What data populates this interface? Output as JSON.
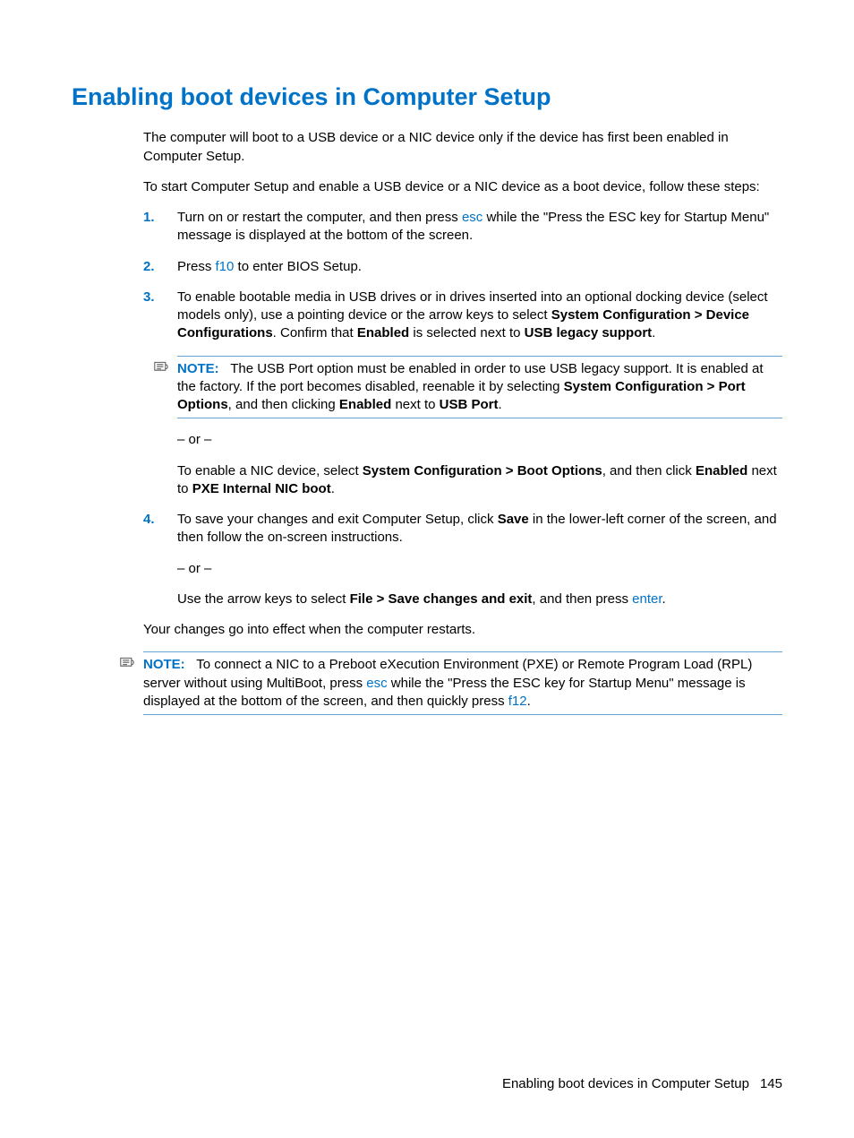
{
  "heading": "Enabling boot devices in Computer Setup",
  "intro1": "The computer will boot to a USB device or a NIC device only if the device has first been enabled in Computer Setup.",
  "intro2": "To start Computer Setup and enable a USB device or a NIC device as a boot device, follow these steps:",
  "steps": {
    "s1": {
      "num": "1.",
      "t1": "Turn on or restart the computer, and then press ",
      "key1": "esc",
      "t2": " while the \"Press the ESC key for Startup Menu\" message is displayed at the bottom of the screen."
    },
    "s2": {
      "num": "2.",
      "t1": "Press ",
      "key1": "f10",
      "t2": " to enter BIOS Setup."
    },
    "s3": {
      "num": "3.",
      "t1": "To enable bootable media in USB drives or in drives inserted into an optional docking device (select models only), use a pointing device or the arrow keys to select ",
      "b1": "System Configuration > Device Configurations",
      "t2": ". Confirm that ",
      "b2": "Enabled",
      "t3": " is selected next to ",
      "b3": "USB legacy support",
      "t4": "."
    },
    "note1": {
      "label": "NOTE:",
      "t1": "The USB Port option must be enabled in order to use USB legacy support. It is enabled at the factory. If the port becomes disabled, reenable it by selecting ",
      "b1": "System Configuration > Port Options",
      "t2": ", and then clicking ",
      "b2": "Enabled",
      "t3": " next to ",
      "b3": "USB Port",
      "t4": "."
    },
    "or1": "– or –",
    "nic": {
      "t1": "To enable a NIC device, select ",
      "b1": "System Configuration > Boot Options",
      "t2": ", and then click ",
      "b2": "Enabled",
      "t3": " next to ",
      "b3": "PXE Internal NIC boot",
      "t4": "."
    },
    "s4": {
      "num": "4.",
      "t1": "To save your changes and exit Computer Setup, click ",
      "b1": "Save",
      "t2": " in the lower-left corner of the screen, and then follow the on-screen instructions."
    },
    "or2": "– or –",
    "arrow": {
      "t1": "Use the arrow keys to select ",
      "b1": "File > Save changes and exit",
      "t2": ", and then press ",
      "key1": "enter",
      "t3": "."
    }
  },
  "closing": "Your changes go into effect when the computer restarts.",
  "note2": {
    "label": "NOTE:",
    "t1": "To connect a NIC to a Preboot eXecution Environment (PXE) or Remote Program Load (RPL) server without using MultiBoot, press ",
    "key1": "esc",
    "t2": " while the \"Press the ESC key for Startup Menu\" message is displayed at the bottom of the screen, and then quickly press ",
    "key2": "f12",
    "t3": "."
  },
  "footer": {
    "title": "Enabling boot devices in Computer Setup",
    "page": "145"
  }
}
